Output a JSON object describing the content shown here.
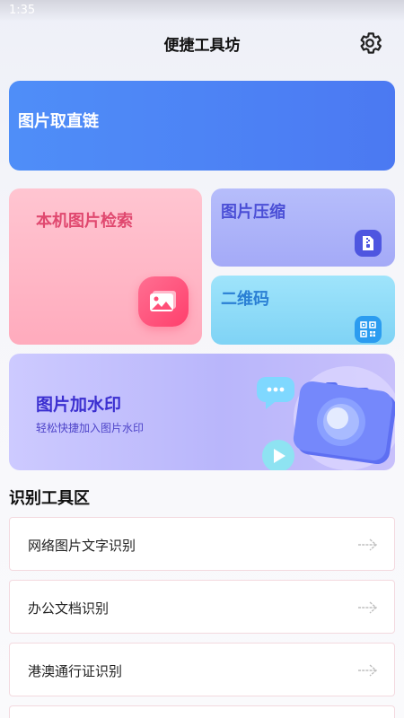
{
  "status_bar": {
    "time": "1:35"
  },
  "header": {
    "title": "便捷工具坊",
    "settings_icon": "gear-icon"
  },
  "cards": {
    "direct_link": {
      "label": "图片取直链"
    },
    "local_search": {
      "label": "本机图片检索",
      "icon": "image-icon"
    },
    "compress": {
      "label": "图片压缩",
      "icon": "compress-icon"
    },
    "qrcode": {
      "label": "二维码",
      "icon": "qrcode-icon"
    },
    "watermark": {
      "label": "图片加水印",
      "subtitle": "轻松快捷加入图片水印",
      "icon": "camera-icon"
    }
  },
  "section": {
    "title": "识别工具区"
  },
  "recognition_items": [
    {
      "label": "网络图片文字识别",
      "icon": "arrow-right-icon"
    },
    {
      "label": "办公文档识别",
      "icon": "arrow-right-icon"
    },
    {
      "label": "港澳通行证识别",
      "icon": "arrow-right-icon"
    }
  ],
  "colors": {
    "direct_link_bg": "#4f8ef8",
    "local_search_text": "#e0486f",
    "compress_text": "#4b4fd6",
    "qrcode_text": "#2a7fd4",
    "watermark_text": "#3b2fd0"
  }
}
